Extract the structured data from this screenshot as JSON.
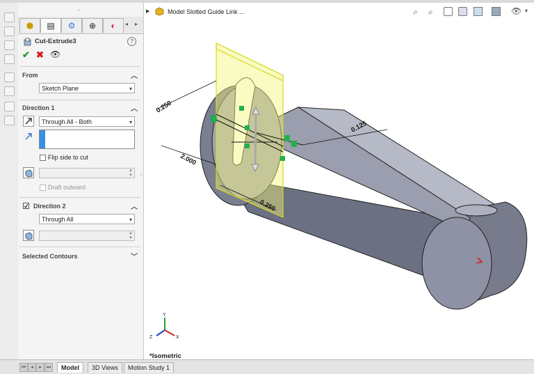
{
  "property_manager": {
    "feature_title": "Cut-Extrude3",
    "from_section": {
      "label": "From",
      "start_condition": "Sketch Plane"
    },
    "direction1": {
      "label": "Direction 1",
      "end_condition": "Through All - Both",
      "flip_side_label": "Flip side to cut",
      "draft_label": "Draft outward"
    },
    "direction2": {
      "label": "Direction 2",
      "end_condition": "Through All"
    },
    "selected_contours_label": "Selected Contours"
  },
  "viewport": {
    "tree_root_label": "Model Slotted Guide Link ...",
    "view_name": "*Isometric",
    "dimensions": [
      "0.250",
      "0.125",
      "2.000",
      "0.250"
    ]
  },
  "bottom_tabs": [
    "Model",
    "3D Views",
    "Motion Study 1"
  ],
  "colors": {
    "accept": "#2e9a2e",
    "cancel": "#d02020",
    "part_face": "#8a8fa3",
    "selection": "#f0f060",
    "active_field": "#3a8ee6"
  }
}
